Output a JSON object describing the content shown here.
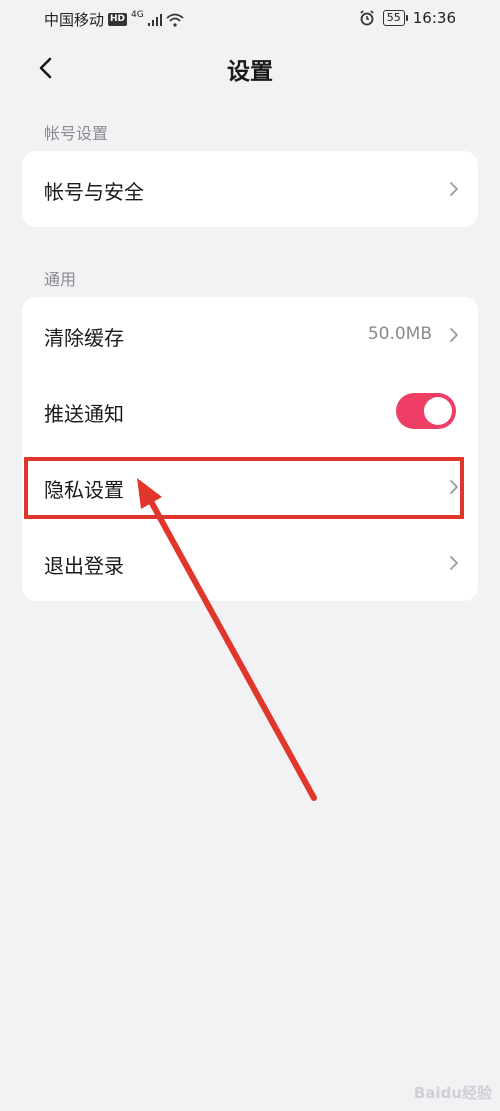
{
  "status": {
    "carrier": "中国移动",
    "hd": "HD",
    "network": "4G",
    "battery": "55",
    "time": "16:36"
  },
  "header": {
    "title": "设置"
  },
  "sections": {
    "account": {
      "label": "帐号设置",
      "items": [
        {
          "label": "帐号与安全"
        }
      ]
    },
    "general": {
      "label": "通用",
      "items": [
        {
          "label": "清除缓存",
          "value": "50.0MB"
        },
        {
          "label": "推送通知",
          "toggle_on": true
        },
        {
          "label": "隐私设置"
        },
        {
          "label": "退出登录"
        }
      ]
    }
  },
  "colors": {
    "accent": "#ee3e65",
    "annotation": "#e0362b"
  },
  "watermark": "Baidu经验"
}
